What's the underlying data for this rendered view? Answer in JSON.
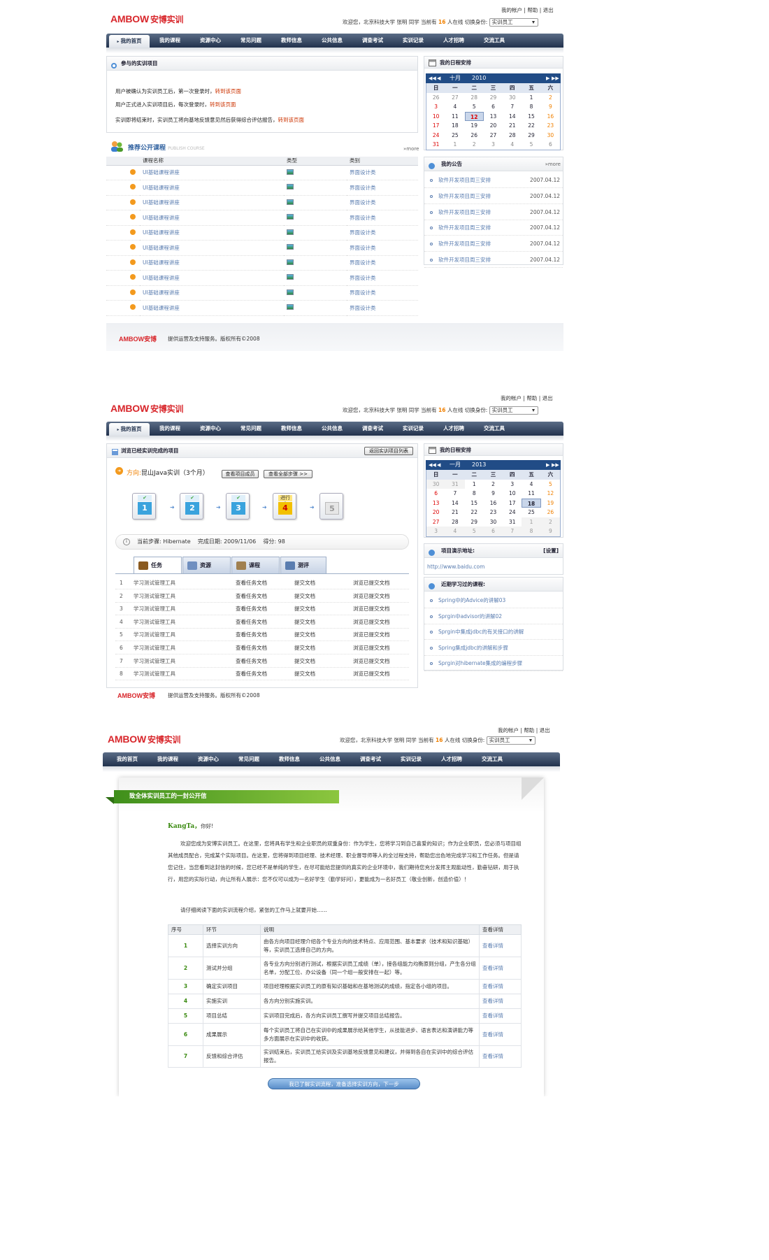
{
  "brand": {
    "logo": "AMBOW",
    "cn": "安博实训",
    "footer_logo": "AMBOW安博"
  },
  "header": {
    "account": "我的帐户",
    "help": "帮助",
    "logout": "退出",
    "sep": "|",
    "welcome_pre": "欢迎您，北京科技大学 张明 同学 当前有",
    "online": "16",
    "welcome_post": "人在线 切换身份:",
    "role": "实训员工"
  },
  "nav": [
    "我的首页",
    "我的课程",
    "资源中心",
    "常见问题",
    "教师信息",
    "公共信息",
    "调查考试",
    "实训记录",
    "人才招聘",
    "交流工具"
  ],
  "footer": "提供运营及支持服务。版权所有©2008",
  "screen1": {
    "project_title": "参与的实训项目",
    "notes": [
      {
        "text": "用户被确认为实训员工后，第一次登录时，",
        "link": "转到该页面"
      },
      {
        "text": "用户正式进入实训项目后，每次登录时，",
        "link": "转到该页面"
      },
      {
        "text": "实训即将结束时，实训员工将向基地反馈意见然后获得综合评估报告，",
        "link": "转到该页面"
      }
    ],
    "course_title": "推荐公开课程",
    "course_en": "PUBLISH COURSE",
    "more": "»more",
    "cols": [
      "课程名称",
      "类型",
      "类别"
    ],
    "courses": [
      {
        "name": "UI基础课程讲座",
        "cat": "界面设计类"
      },
      {
        "name": "UI基础课程讲座",
        "cat": "界面设计类"
      },
      {
        "name": "UI基础课程讲座",
        "cat": "界面设计类"
      },
      {
        "name": "UI基础课程讲座",
        "cat": "界面设计类"
      },
      {
        "name": "UI基础课程讲座",
        "cat": "界面设计类"
      },
      {
        "name": "UI基础课程讲座",
        "cat": "界面设计类"
      },
      {
        "name": "UI基础课程讲座",
        "cat": "界面设计类"
      },
      {
        "name": "UI基础课程讲座",
        "cat": "界面设计类"
      },
      {
        "name": "UI基础课程讲座",
        "cat": "界面设计类"
      },
      {
        "name": "UI基础课程讲座",
        "cat": "界面设计类"
      }
    ],
    "schedule_title": "我的日程安排",
    "cal": {
      "month": "十月",
      "year": "2010",
      "weekdays": [
        "日",
        "一",
        "二",
        "三",
        "四",
        "五",
        "六"
      ],
      "days": [
        "26",
        "27",
        "28",
        "29",
        "30",
        "1",
        "2",
        "3",
        "4",
        "5",
        "6",
        "7",
        "8",
        "9",
        "10",
        "11",
        "12",
        "13",
        "14",
        "15",
        "16",
        "17",
        "18",
        "19",
        "20",
        "21",
        "22",
        "23",
        "24",
        "25",
        "26",
        "27",
        "28",
        "29",
        "30",
        "31",
        "1",
        "2",
        "3",
        "4",
        "5",
        "6"
      ],
      "today": "12"
    },
    "notice_title": "我的公告",
    "notice_more": "»more",
    "notices": [
      {
        "text": "软件开发项目周三安排",
        "date": "2007.04.12"
      },
      {
        "text": "软件开发项目周三安排",
        "date": "2007.04.12"
      },
      {
        "text": "软件开发项目周三安排",
        "date": "2007.04.12"
      },
      {
        "text": "软件开发项目周三安排",
        "date": "2007.04.12"
      },
      {
        "text": "软件开发项目周三安排",
        "date": "2007.04.12"
      },
      {
        "text": "软件开发项目周三安排",
        "date": "2007.04.12"
      }
    ]
  },
  "screen2": {
    "title": "浏览已经实训完成的项目",
    "back": "返回实训项目列表",
    "direction_label": "方向:",
    "direction": "昆山Java实训（3个月）",
    "btn_members": "查看项目成员",
    "btn_steps": "查看全部步骤 >>",
    "steps": [
      "1",
      "2",
      "3",
      "4",
      "5"
    ],
    "in_progress": "进行中",
    "check": "✔",
    "current_label": "当前步骤:",
    "current": "Hibernate",
    "done_label": "完成日期:",
    "done": "2009/11/06",
    "score_label": "得分:",
    "score": "98",
    "tabs": [
      "任务",
      "资源",
      "课程",
      "测评"
    ],
    "rows": [
      {
        "n": "1",
        "name": "学习测试管理工具",
        "a": "查看任务文档",
        "b": "提交文档",
        "c": "浏览已提交文档"
      },
      {
        "n": "2",
        "name": "学习测试管理工具",
        "a": "查看任务文档",
        "b": "提交文档",
        "c": "浏览已提交文档"
      },
      {
        "n": "3",
        "name": "学习测试管理工具",
        "a": "查看任务文档",
        "b": "提交文档",
        "c": "浏览已提交文档"
      },
      {
        "n": "4",
        "name": "学习测试管理工具",
        "a": "查看任务文档",
        "b": "提交文档",
        "c": "浏览已提交文档"
      },
      {
        "n": "5",
        "name": "学习测试管理工具",
        "a": "查看任务文档",
        "b": "提交文档",
        "c": "浏览已提交文档"
      },
      {
        "n": "6",
        "name": "学习测试管理工具",
        "a": "查看任务文档",
        "b": "提交文档",
        "c": "浏览已提交文档"
      },
      {
        "n": "7",
        "name": "学习测试管理工具",
        "a": "查看任务文档",
        "b": "提交文档",
        "c": "浏览已提交文档"
      },
      {
        "n": "8",
        "name": "学习测试管理工具",
        "a": "查看任务文档",
        "b": "提交文档",
        "c": "浏览已提交文档"
      }
    ],
    "schedule_title": "我的日程安排",
    "cal": {
      "month": "一月",
      "year": "2013",
      "weekdays": [
        "日",
        "一",
        "二",
        "三",
        "四",
        "五",
        "六"
      ],
      "days": [
        "30",
        "31",
        "1",
        "2",
        "3",
        "4",
        "5",
        "6",
        "7",
        "8",
        "9",
        "10",
        "11",
        "12",
        "13",
        "14",
        "15",
        "16",
        "17",
        "18",
        "19",
        "20",
        "21",
        "22",
        "23",
        "24",
        "25",
        "26",
        "27",
        "28",
        "29",
        "30",
        "31",
        "1",
        "2",
        "3",
        "4",
        "5",
        "6",
        "7",
        "8",
        "9"
      ],
      "today": "18"
    },
    "demo_title": "项目演示地址:",
    "demo_set": "[设置]",
    "demo_url": "http://www.baidu.com",
    "recent_title": "近期学习过的课程:",
    "recent": [
      "Spring中的Advice的讲解03",
      "Sprgin中advisor的讲解02",
      "Sprgin中集成jdbc的有关接口的讲解",
      "Spring集成jdbc的讲解和步骤",
      "Sprgin对hibernate集成的编程步骤"
    ]
  },
  "screen3": {
    "ribbon": "致全体实训员工的一封公开信",
    "greet_name": "KangTa，",
    "greet": "你好!",
    "para": "欢迎您成为安博实训员工。在这里，您将具有学生和企业职员的双重身份：作为学生，您将学习到自己喜爱的知识；作为企业职员，您必须与项目组其他成员配合，完成某个实际项目。在这里，您将得到项目经理、技术经理、职业督导师等人的全过程支持，帮助您出色地完成学习和工作任务。但是请您记住，当您看到这封信的时候，您已经不是单纯的学生，在尽可能给您提供的真实的企业环境中，我们期待您充分发挥主观能动性，勤奋钻研，用于执行，用您的实际行动，向让所有人展示：您不仅可以成为一名好学生（勤学好问），更能成为一名好员工（敬业创新，创造价值）！",
    "intro": "请仔细阅读下面的实训流程介绍，紧张的工作马上就要开始……",
    "cols": [
      "序号",
      "环节",
      "说明",
      "查看详情"
    ],
    "rows": [
      {
        "n": "1",
        "step": "选择实训方向",
        "desc": "由各方向项目经理介绍各个专业方向的技术特点、应用范围、基本要求（技术和知识基础）等，实训员工选择自己的方向。",
        "link": "查看详情"
      },
      {
        "n": "2",
        "step": "测试并分组",
        "desc": "各专业方向分别进行测试，根据实训员工成绩（单），接各组能力均衡原则分组，产生各分组名单，分配工位、办公设备（同一个组一般安排在一起）等。",
        "link": "查看详情"
      },
      {
        "n": "3",
        "step": "确定实训项目",
        "desc": "项目经理根据实训员工的原有知识基础和在基地测试的成绩，指定各小组的项目。",
        "link": "查看详情"
      },
      {
        "n": "4",
        "step": "实施实训",
        "desc": "各方向分别实施实训。",
        "link": "查看详情"
      },
      {
        "n": "5",
        "step": "项目总结",
        "desc": "实训项目完成后，各方向实训员工撰写并提交项目总结报告。",
        "link": "查看详情"
      },
      {
        "n": "6",
        "step": "成果展示",
        "desc": "每个实训员工将自己在实训中的成果展示给其他学生，从技能进步、语言表达和演讲能力等多方面展示在实训中的收获。",
        "link": "查看详情"
      },
      {
        "n": "7",
        "step": "反馈和综合评估",
        "desc": "实训结束后，实训员工给实训及实训基地反馈意见和建议，并得到各自在实训中的综合评估报告。",
        "link": "查看详情"
      }
    ],
    "cta": "我已了解实训流程，准备选择实训方向，下一步"
  }
}
